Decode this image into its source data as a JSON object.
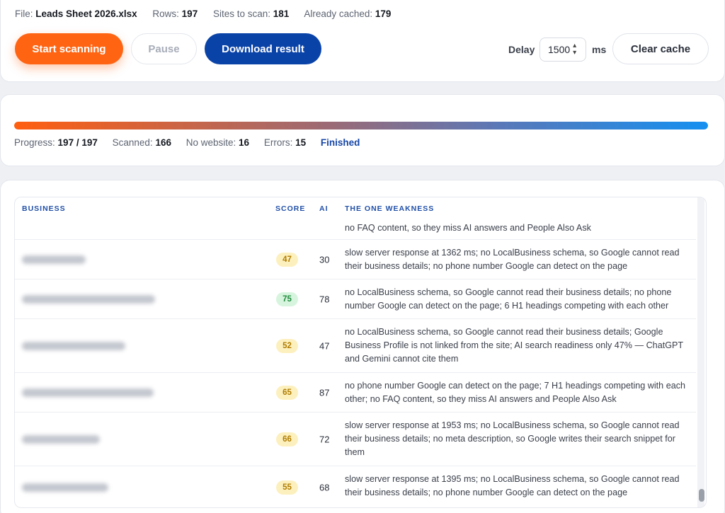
{
  "meta": {
    "file_label": "File:",
    "file_name": "Leads Sheet 2026.xlsx",
    "rows_label": "Rows:",
    "rows": "197",
    "sites_label": "Sites to scan:",
    "sites": "181",
    "cached_label": "Already cached:",
    "cached": "179"
  },
  "toolbar": {
    "start_label": "Start scanning",
    "pause_label": "Pause",
    "download_label": "Download result",
    "delay_label": "Delay",
    "delay_value": "1500",
    "delay_unit": "ms",
    "clear_label": "Clear cache"
  },
  "progress": {
    "fraction": 1.0,
    "progress_label": "Progress:",
    "progress_value": "197 / 197",
    "scanned_label": "Scanned:",
    "scanned": "166",
    "nowebsite_label": "No website:",
    "nowebsite": "16",
    "errors_label": "Errors:",
    "errors": "15",
    "status": "Finished"
  },
  "table": {
    "headers": {
      "business": "BUSINESS",
      "score": "SCORE",
      "ai": "AI",
      "weakness": "THE ONE WEAKNESS"
    },
    "partial_row": {
      "weakness": "no FAQ content, so they miss AI answers and People Also Ask"
    },
    "rows": [
      {
        "score": "47",
        "score_level": "mid",
        "ai": "30",
        "weakness": "slow server response at 1362 ms; no LocalBusiness schema, so Google cannot read their business details; no phone number Google can detect on the page"
      },
      {
        "score": "75",
        "score_level": "good",
        "ai": "78",
        "weakness": "no LocalBusiness schema, so Google cannot read their business details; no phone number Google can detect on the page; 6 H1 headings competing with each other"
      },
      {
        "score": "52",
        "score_level": "mid",
        "ai": "47",
        "weakness": "no LocalBusiness schema, so Google cannot read their business details; Google Business Profile is not linked from the site; AI search readiness only 47% — ChatGPT and Gemini cannot cite them"
      },
      {
        "score": "65",
        "score_level": "mid",
        "ai": "87",
        "weakness": "no phone number Google can detect on the page; 7 H1 headings competing with each other; no FAQ content, so they miss AI answers and People Also Ask"
      },
      {
        "score": "66",
        "score_level": "mid",
        "ai": "72",
        "weakness": "slow server response at 1953 ms; no LocalBusiness schema, so Google cannot read their business details; no meta description, so Google writes their search snippet for them"
      },
      {
        "score": "55",
        "score_level": "mid",
        "ai": "68",
        "weakness": "slow server response at 1395 ms; no LocalBusiness schema, so Google cannot read their business details; no phone number Google can detect on the page"
      }
    ]
  },
  "colors": {
    "primary_orange": "#ff6412",
    "primary_blue": "#0a43a8",
    "status_blue": "#1747a6"
  }
}
